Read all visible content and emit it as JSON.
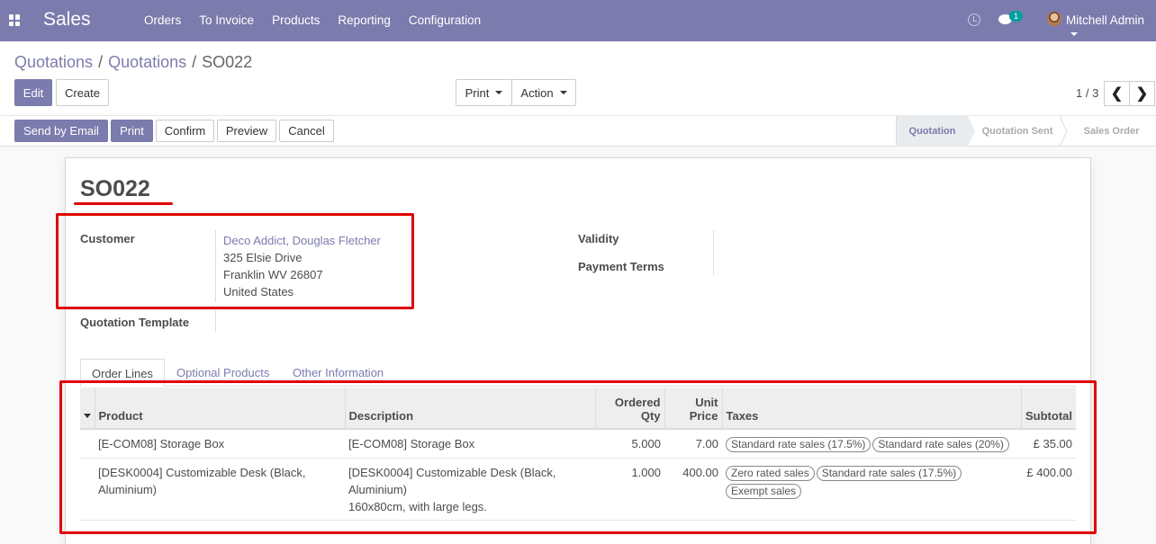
{
  "navbar": {
    "app_name": "Sales",
    "menu": [
      "Orders",
      "To Invoice",
      "Products",
      "Reporting",
      "Configuration"
    ],
    "chat_badge": "1",
    "user": "Mitchell Admin"
  },
  "breadcrumb": {
    "parts": [
      "Quotations",
      "Quotations",
      "SO022"
    ]
  },
  "toolbar": {
    "edit": "Edit",
    "create": "Create",
    "print": "Print",
    "action": "Action",
    "pager": "1 / 3",
    "prev": "❮",
    "next": "❯"
  },
  "header_buttons": {
    "send_email": "Send by Email",
    "print": "Print",
    "confirm": "Confirm",
    "preview": "Preview",
    "cancel": "Cancel"
  },
  "status": {
    "stages": [
      "Quotation",
      "Quotation Sent",
      "Sales Order"
    ],
    "active": "Quotation"
  },
  "form": {
    "name": "SO022",
    "customer_label": "Customer",
    "customer_name": "Deco Addict, Douglas Fletcher",
    "customer_address": [
      "325 Elsie Drive",
      "Franklin WV 26807",
      "United States"
    ],
    "template_label": "Quotation Template",
    "validity_label": "Validity",
    "payment_terms_label": "Payment Terms"
  },
  "tabs": [
    "Order Lines",
    "Optional Products",
    "Other Information"
  ],
  "order_lines": {
    "columns": {
      "product": "Product",
      "description": "Description",
      "qty_1": "Ordered",
      "qty_2": "Qty",
      "price_1": "Unit",
      "price_2": "Price",
      "taxes": "Taxes",
      "subtotal": "Subtotal"
    },
    "rows": [
      {
        "product": "[E-COM08] Storage Box",
        "description": [
          "[E-COM08] Storage Box"
        ],
        "qty": "5.000",
        "price": "7.00",
        "taxes": [
          "Standard rate sales (17.5%)",
          "Standard rate sales (20%)"
        ],
        "subtotal": "£ 35.00"
      },
      {
        "product": "[DESK0004] Customizable Desk (Black, Aluminium)",
        "description": [
          "[DESK0004] Customizable Desk (Black, Aluminium)",
          "160x80cm, with large legs."
        ],
        "qty": "1.000",
        "price": "400.00",
        "taxes": [
          "Zero rated sales",
          "Standard rate sales (17.5%)",
          "Exempt sales"
        ],
        "subtotal": "£ 400.00"
      }
    ]
  }
}
